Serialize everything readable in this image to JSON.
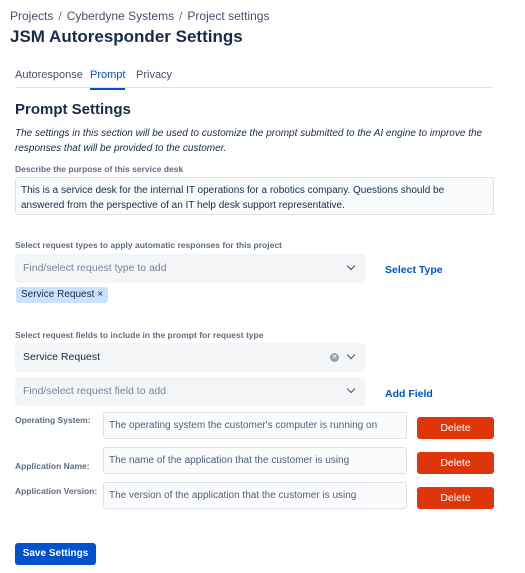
{
  "breadcrumb": {
    "items": [
      "Projects",
      "Cyberdyne Systems",
      "Project settings"
    ],
    "separator": "/"
  },
  "page_title": "JSM Autoresponder Settings",
  "tabs": [
    {
      "label": "Autoresponse",
      "active": false
    },
    {
      "label": "Prompt",
      "active": true
    },
    {
      "label": "Privacy",
      "active": false
    }
  ],
  "section": {
    "title": "Prompt Settings",
    "description": "The settings in this section will be used to customize the prompt submitted to the AI engine to improve the responses that will be provided to the customer."
  },
  "purpose": {
    "label": "Describe the purpose of this service desk",
    "value": "This is a service desk for the internal IT operations for a robotics company. Questions should be answered from the perspective of an IT help desk support representative."
  },
  "request_types": {
    "label": "Select request types to apply automatic responses for this project",
    "placeholder": "Find/select request type to add",
    "select_button": "Select Type",
    "selected": [
      {
        "label": "Service Request",
        "remove": "×"
      }
    ]
  },
  "request_fields": {
    "label": "Select request fields to include in the prompt for request type",
    "type_value": "Service Request",
    "field_placeholder": "Find/select request field to add",
    "add_button": "Add Field",
    "fields": [
      {
        "name": "Operating System:",
        "description": "The operating system the customer's computer is running on",
        "delete_label": "Delete"
      },
      {
        "name": "Application Name:",
        "description": "The name of the application that the customer is using",
        "delete_label": "Delete"
      },
      {
        "name": "Application Version:",
        "description": "The version of the application that the customer is using",
        "delete_label": "Delete"
      }
    ]
  },
  "save_button": "Save Settings",
  "colors": {
    "primary": "#0052cc",
    "danger": "#de350b",
    "tag": "#cce0ff",
    "text": "#172b4d"
  }
}
